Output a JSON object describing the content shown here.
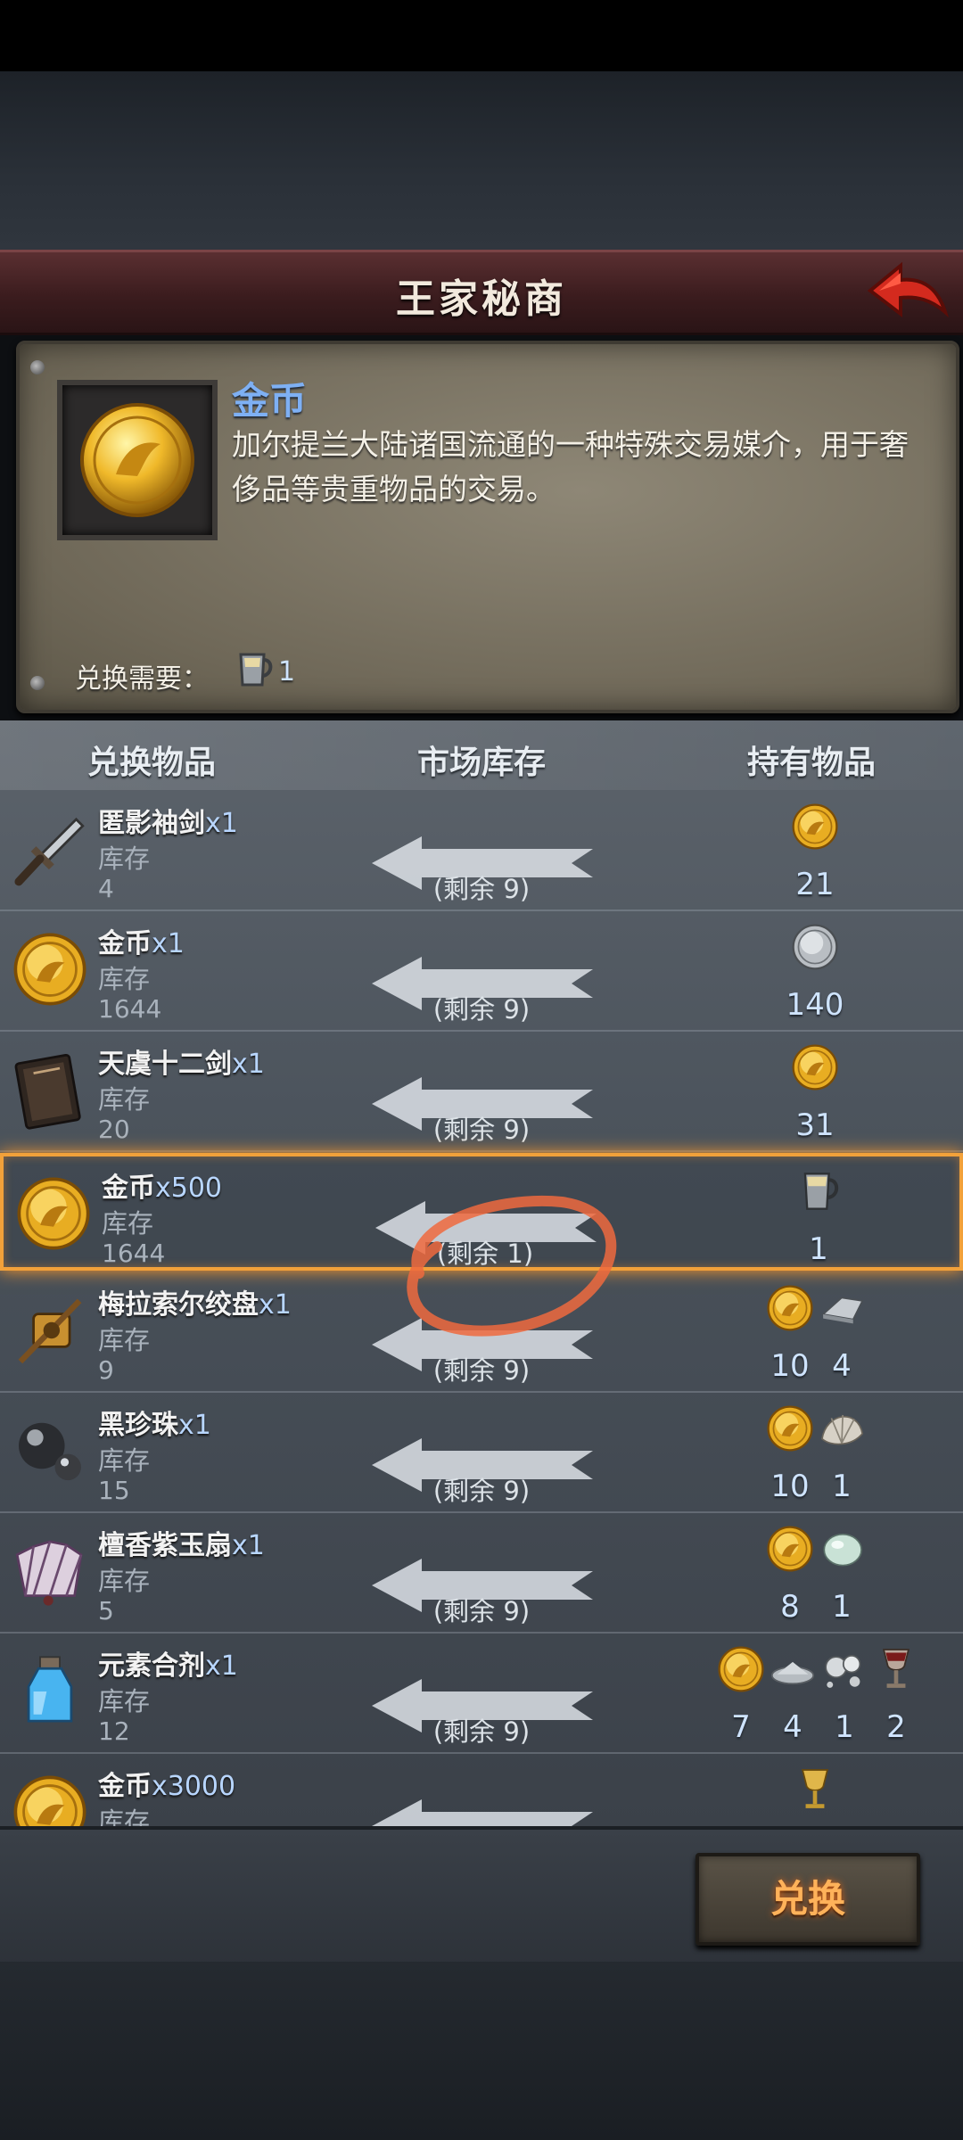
{
  "title": "王家秘商",
  "info": {
    "item_name": "金币",
    "description": "加尔提兰大陆诸国流通的一种特殊交易媒介，用于奢侈品等贵重物品的交易。",
    "requirement_label": "兑换需要：",
    "requirement_value": "1",
    "requirement_icon": "silver-cup-icon"
  },
  "headers": {
    "exchange_item": "兑换物品",
    "market_stock": "市场库存",
    "held_items": "持有物品"
  },
  "rows": [
    {
      "name": "匿影袖剑",
      "qty": "x1",
      "stock_label": "库存",
      "stock": "4",
      "remain": "(剩余 9)",
      "icon": "dagger-icon",
      "costs": [
        {
          "icon": "gold-coin-icon",
          "value": "21"
        }
      ]
    },
    {
      "name": "金币",
      "qty": "x1",
      "stock_label": "库存",
      "stock": "1644",
      "remain": "(剩余 9)",
      "icon": "gold-coin-icon",
      "costs": [
        {
          "icon": "silver-coin-icon",
          "value": "140"
        }
      ]
    },
    {
      "name": "天虞十二剑",
      "qty": "x1",
      "stock_label": "库存",
      "stock": "20",
      "remain": "(剩余 9)",
      "icon": "book-icon",
      "costs": [
        {
          "icon": "gold-coin-icon",
          "value": "31"
        }
      ]
    },
    {
      "name": "金币",
      "qty": "x500",
      "stock_label": "库存",
      "stock": "1644",
      "remain": "(剩余 1)",
      "icon": "gold-coin-icon",
      "costs": [
        {
          "icon": "silver-cup-icon",
          "value": "1"
        }
      ]
    },
    {
      "name": "梅拉索尔绞盘",
      "qty": "x1",
      "stock_label": "库存",
      "stock": "9",
      "remain": "(剩余 9)",
      "icon": "winch-icon",
      "costs": [
        {
          "icon": "gold-coin-icon",
          "value": "10"
        },
        {
          "icon": "iron-ingot-icon",
          "value": "4"
        }
      ]
    },
    {
      "name": "黑珍珠",
      "qty": "x1",
      "stock_label": "库存",
      "stock": "15",
      "remain": "(剩余 9)",
      "icon": "black-pearl-icon",
      "costs": [
        {
          "icon": "gold-coin-icon",
          "value": "10"
        },
        {
          "icon": "shell-icon",
          "value": "1"
        }
      ]
    },
    {
      "name": "檀香紫玉扇",
      "qty": "x1",
      "stock_label": "库存",
      "stock": "5",
      "remain": "(剩余 9)",
      "icon": "fan-icon",
      "costs": [
        {
          "icon": "gold-coin-icon",
          "value": "8"
        },
        {
          "icon": "jade-stone-icon",
          "value": "1"
        }
      ]
    },
    {
      "name": "元素合剂",
      "qty": "x1",
      "stock_label": "库存",
      "stock": "12",
      "remain": "(剩余 9)",
      "icon": "potion-icon",
      "costs": [
        {
          "icon": "gold-coin-icon",
          "value": "7"
        },
        {
          "icon": "silver-dust-icon",
          "value": "4"
        },
        {
          "icon": "mushroom-icon",
          "value": "1"
        },
        {
          "icon": "goblet-icon",
          "value": "2"
        }
      ]
    },
    {
      "name": "金币",
      "qty": "x3000",
      "stock_label": "库存",
      "stock": "",
      "remain": "",
      "icon": "gold-coin-icon",
      "costs": [
        {
          "icon": "golden-chalice-icon",
          "value": ""
        }
      ]
    }
  ],
  "exchange_button": "兑换",
  "colors": {
    "title_bar": "#3b1c1e",
    "accent_blue": "#7eb0f4",
    "selection": "#f2a13a",
    "button_text": "#ffb25a"
  },
  "selected_row": 3
}
